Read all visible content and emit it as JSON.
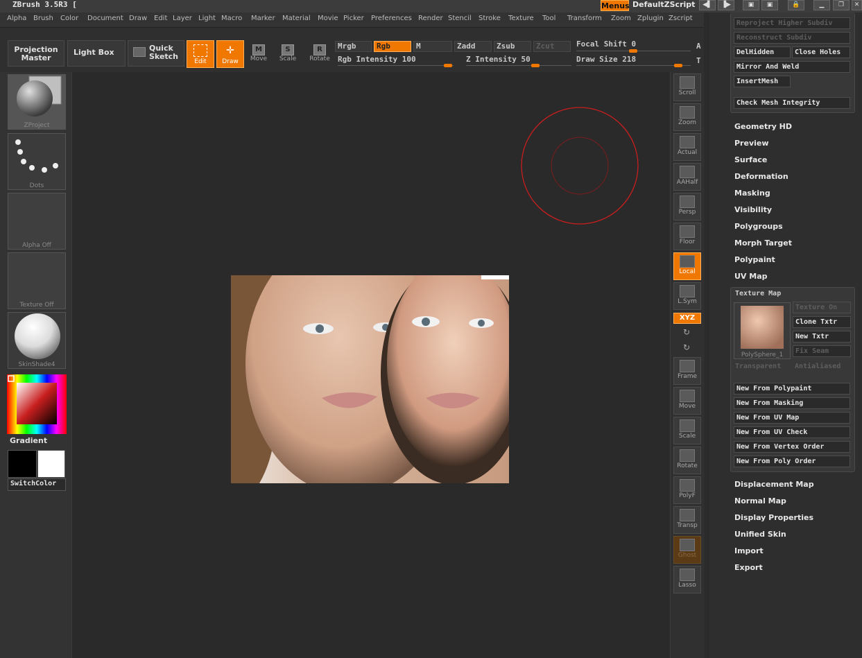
{
  "app": {
    "title": "ZBrush 3.5R3 [",
    "menus_label": "Menus",
    "script_name": "DefaultZScript"
  },
  "menubar": [
    "Alpha",
    "Brush",
    "Color",
    "Document",
    "Draw",
    "Edit",
    "Layer",
    "Light",
    "Macro",
    "Marker",
    "Material",
    "Movie",
    "Picker",
    "Preferences",
    "Render",
    "Stencil",
    "Stroke",
    "Texture",
    "Tool",
    "Transform",
    "Zoom",
    "Zplugin",
    "Zscript"
  ],
  "toolbar": {
    "projection_master_line1": "Projection",
    "projection_master_line2": "Master",
    "light_box": "Light Box",
    "quick_sketch_line1": "Quick",
    "quick_sketch_line2": "Sketch",
    "edit": "Edit",
    "draw": "Draw",
    "move": "Move",
    "scale": "Scale",
    "rotate": "Rotate",
    "mrgb": "Mrgb",
    "rgb": "Rgb",
    "m": "M",
    "zadd": "Zadd",
    "zsub": "Zsub",
    "zcut": "Zcut",
    "rgb_intensity": "Rgb Intensity 100",
    "z_intensity": "Z Intensity 50",
    "focal_shift": "Focal Shift 0",
    "draw_size": "Draw Size 218",
    "edge_a": "A",
    "edge_t": "T",
    "rgb_intensity_value": 100,
    "z_intensity_value": 50,
    "focal_shift_value": 0,
    "draw_size_value": 218
  },
  "leftshelf": {
    "zproject": "ZProject",
    "dots": "Dots",
    "alpha_off": "Alpha  Off",
    "texture_off": "Texture  Off",
    "skinshade": "SkinShade4",
    "gradient": "Gradient",
    "switchcolor": "SwitchColor",
    "primary_color": "#000000",
    "secondary_color": "#ffffff"
  },
  "rightshelf": {
    "scroll": "Scroll",
    "zoom": "Zoom",
    "actual": "Actual",
    "aahalf": "AAHalf",
    "persp": "Persp",
    "floor": "Floor",
    "local": "Local",
    "lsym": "L.Sym",
    "xyz": "XYZ",
    "frame": "Frame",
    "move": "Move",
    "scale": "Scale",
    "rotate": "Rotate",
    "polyf": "PolyF",
    "transp": "Transp",
    "ghost": "Ghost",
    "lasso": "Lasso"
  },
  "rightpanel": {
    "reproject": "Reproject Higher Subdiv",
    "reconstruct": "Reconstruct Subdiv",
    "delhidden": "DelHidden",
    "closeholes": "Close Holes",
    "mirrorweld": "Mirror And Weld",
    "insertmesh": "InsertMesh",
    "checkmesh": "Check Mesh Integrity",
    "sections_top": [
      "Geometry HD",
      "Preview",
      "Surface",
      "Deformation",
      "Masking",
      "Visibility",
      "Polygroups",
      "Morph Target",
      "Polypaint",
      "UV Map"
    ],
    "texture_map": {
      "title": "Texture Map",
      "thumb_label": "PolySphere_1",
      "texture_on": "Texture On",
      "clone_txtr": "Clone Txtr",
      "new_txtr": "New Txtr",
      "fix_seam": "Fix Seam",
      "transparent": "Transparent",
      "antialiased": "Antialiased",
      "new_buttons": [
        "New From Polypaint",
        "New From Masking",
        "New From UV Map",
        "New From UV Check",
        "New From Vertex Order",
        "New From Poly Order"
      ]
    },
    "sections_bottom": [
      "Displacement Map",
      "Normal Map",
      "Display Properties",
      "Unified Skin",
      "Import",
      "Export"
    ]
  },
  "colors": {
    "accent": "#f07800",
    "brush_ring": "#c81e1e"
  }
}
